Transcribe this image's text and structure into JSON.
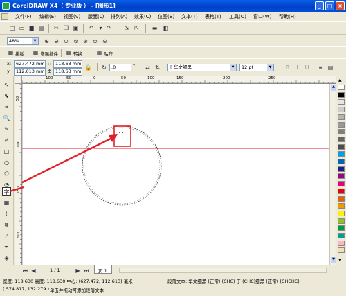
{
  "window": {
    "title": "CorelDRAW X4（ 专业版 ） - [图形1]",
    "min": "_",
    "max": "□",
    "close": "×"
  },
  "menu": [
    {
      "label": "文件(F)"
    },
    {
      "label": "编辑(E)"
    },
    {
      "label": "视图(V)"
    },
    {
      "label": "版面(L)"
    },
    {
      "label": "排列(A)"
    },
    {
      "label": "效果(C)"
    },
    {
      "label": "位图(B)"
    },
    {
      "label": "文本(T)"
    },
    {
      "label": "表格(T)"
    },
    {
      "label": "工具(O)"
    },
    {
      "label": "窗口(W)"
    },
    {
      "label": "帮助(H)"
    }
  ],
  "zoom": {
    "value": "48%"
  },
  "toolbar3": {
    "layout_label": "排版",
    "plugin_label": "增强插件",
    "convert_label": "转换",
    "align_label": "贴齐"
  },
  "props": {
    "x_label": "x:",
    "x_value": "627.472 mm",
    "y_label": "y:",
    "y_value": "112.613 mm",
    "w_value": "118.63 mm",
    "h_value": "118.63 mm",
    "angle_value": ".0",
    "font_name": "华文细黑",
    "font_size": "12 pt"
  },
  "ruler": {
    "labels_h": [
      "100",
      "50",
      "0",
      "50",
      "100",
      "150",
      "200",
      "250"
    ],
    "labels_v": [
      "50",
      "100",
      "150",
      "200"
    ]
  },
  "palette_colors": [
    "#ffffff",
    "#000000",
    "#e6e6e6",
    "#cccccc",
    "#b3b3b3",
    "#999999",
    "#808080",
    "#666666",
    "#4d4d4d",
    "#00a0e9",
    "#0068b7",
    "#1d2088",
    "#920783",
    "#e4007f",
    "#e60012",
    "#eb6100",
    "#f39800",
    "#fff100",
    "#8fc31f",
    "#009944",
    "#009e96",
    "#ffb6c1",
    "#f5deb3"
  ],
  "pagebar": {
    "page_count": "1 / 1",
    "page_tab": "页 1"
  },
  "status": {
    "dimensions": "宽度: 118.630  高度: 118.630  中心: (627.472, 112.613)  毫米",
    "object_info": "段落文本: 华文细黑 (正常) (CHC) 于 (CHC)细黑 (正常) (CHCHC)",
    "cursor": "( 574.817, 132.279 )",
    "hint": "单击并拖动可添加段落文本"
  },
  "colors": {
    "guide": "#e0202a",
    "annotation": "#e0202a",
    "titlebar": "#0a5fe8"
  }
}
